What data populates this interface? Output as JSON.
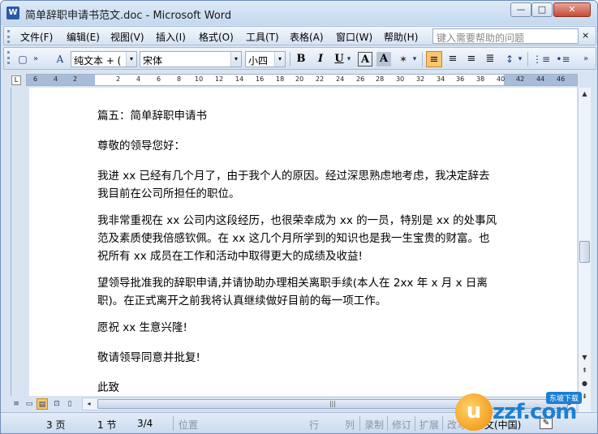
{
  "window": {
    "title": "简单辞职申请书范文.doc - Microsoft Word",
    "app_icon": "word-doc-icon",
    "app_icon_glyph": "W",
    "minimize": "—",
    "maximize": "□",
    "close": "✕"
  },
  "menubar": {
    "items": [
      "文件(F)",
      "编辑(E)",
      "视图(V)",
      "插入(I)",
      "格式(O)",
      "工具(T)",
      "表格(A)",
      "窗口(W)",
      "帮助(H)"
    ],
    "help_placeholder": "键入需要帮助的问题",
    "help_close": "×"
  },
  "toolbar": {
    "style": "纯文本 + (",
    "font": "宋体",
    "size": "小四",
    "bold": "B",
    "italic": "I",
    "underline": "U",
    "char_border": "A",
    "char_shading": "A",
    "highlight": "✶",
    "dropdown": "▾",
    "new_doc_glyph": "▢",
    "styles_pane_glyph": "A",
    "align_left_glyph": "≡",
    "center_glyph": "≡",
    "align_right_glyph": "≡",
    "justify_glyph": "≣",
    "line_spacing_glyph": "↕",
    "numbering_glyph": "⋮≡",
    "bullets_glyph": "•≡",
    "overflow_glyph": "»",
    "active_alignment": "align-left"
  },
  "ruler": {
    "corner_glyph": "L",
    "ticks": [
      "6",
      "4",
      "2",
      "2",
      "4",
      "6",
      "8",
      "10",
      "12",
      "14",
      "16",
      "18",
      "20",
      "22",
      "24",
      "26",
      "28",
      "30",
      "32",
      "34",
      "36",
      "38",
      "40",
      "42",
      "44",
      "46"
    ]
  },
  "document": {
    "paragraphs": [
      "篇五：简单辞职申请书",
      "尊敬的领导您好：",
      "我进 xx 已经有几个月了，由于我个人的原因。经过深思熟虑地考虑，我决定辞去",
      "我目前在公司所担任的职位。",
      "我非常重视在 xx 公司内这段经历，也很荣幸成为 xx 的一员，特别是 xx 的处事风",
      "范及素质使我倍感钦佩。在 xx 这几个月所学到的知识也是我一生宝贵的财富。也",
      "祝所有 xx 成员在工作和活动中取得更大的成绩及收益!",
      "望领导批准我的辞职申请,并请协助办理相关离职手续(本人在 2xx 年 x 月 x 日离",
      "职)。在正式离开之前我将认真继续做好目前的每一项工作。",
      "愿祝 xx 生意兴隆!",
      "敬请领导同意并批复!",
      "此致"
    ]
  },
  "scrollbar": {
    "up": "▲",
    "down": "▼",
    "prev_page": "⇞",
    "select_browse": "●",
    "next_page": "⇟",
    "hscroll_left": "◂",
    "hscroll_right": "▸",
    "thumb_grip": "|||"
  },
  "views": {
    "glyphs": [
      "≡",
      "▭",
      "▤",
      "⊡",
      "▯"
    ],
    "active": "print-layout"
  },
  "status": {
    "page": "3 页",
    "section": "1 节",
    "page_of": "3/4",
    "position": "位置",
    "line": "行",
    "column": "列",
    "record": "录制",
    "revise": "修订",
    "extend": "扩展",
    "overtype": "改写",
    "language": "中文(中国)",
    "spell_icon": "spell-check-icon",
    "spell_glyph": "✎"
  },
  "watermark": {
    "mark": "u",
    "text": "zzf.com",
    "badge": "东坡下载"
  },
  "colors": {
    "accent": "#f9c572",
    "titlebar": "#c4d8ef",
    "close_button": "#c74a35",
    "logo_blue": "#1d7fd2",
    "logo_orange": "#f08a00"
  }
}
